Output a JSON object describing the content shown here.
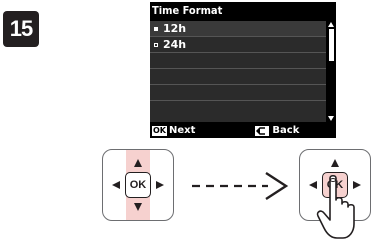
{
  "step": {
    "number": "15"
  },
  "lcd": {
    "title": "Time Format",
    "options": [
      {
        "label": "12h",
        "selected": true
      },
      {
        "label": "24h",
        "selected": false
      }
    ],
    "footer": {
      "ok_key": "OK",
      "next_label": "Next",
      "back_label": "Back"
    }
  },
  "control_pad": {
    "ok_label": "OK",
    "highlight_color": "#f6d1cf"
  }
}
